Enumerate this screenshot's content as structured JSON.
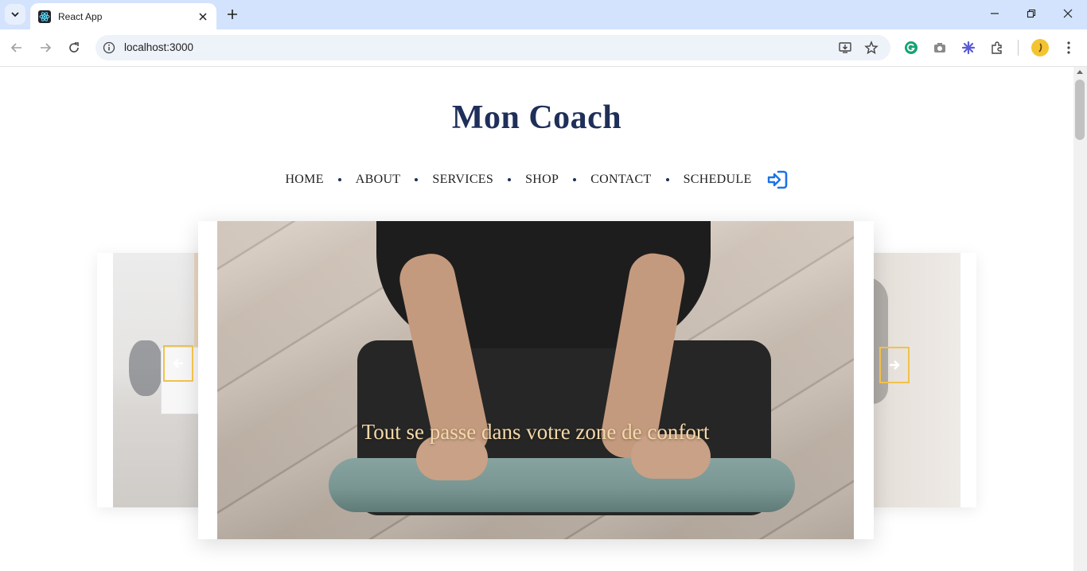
{
  "browser": {
    "tab_title": "React App",
    "url": "localhost:3000"
  },
  "site": {
    "brand": "Mon Coach",
    "nav": [
      {
        "label": "HOME"
      },
      {
        "label": "ABOUT"
      },
      {
        "label": "SERVICES"
      },
      {
        "label": "SHOP"
      },
      {
        "label": "CONTACT"
      },
      {
        "label": "SCHEDULE"
      }
    ]
  },
  "carousel": {
    "caption": "Tout se passe dans votre zone de confort"
  },
  "colors": {
    "brand": "#1f2f5a",
    "accent_gold": "#f0c14b",
    "login_icon": "#1a73e8",
    "caption": "#f6d9a8"
  },
  "icons": {
    "login": "sign-in-icon",
    "prev": "arrow-left-icon",
    "next": "arrow-right-icon"
  }
}
